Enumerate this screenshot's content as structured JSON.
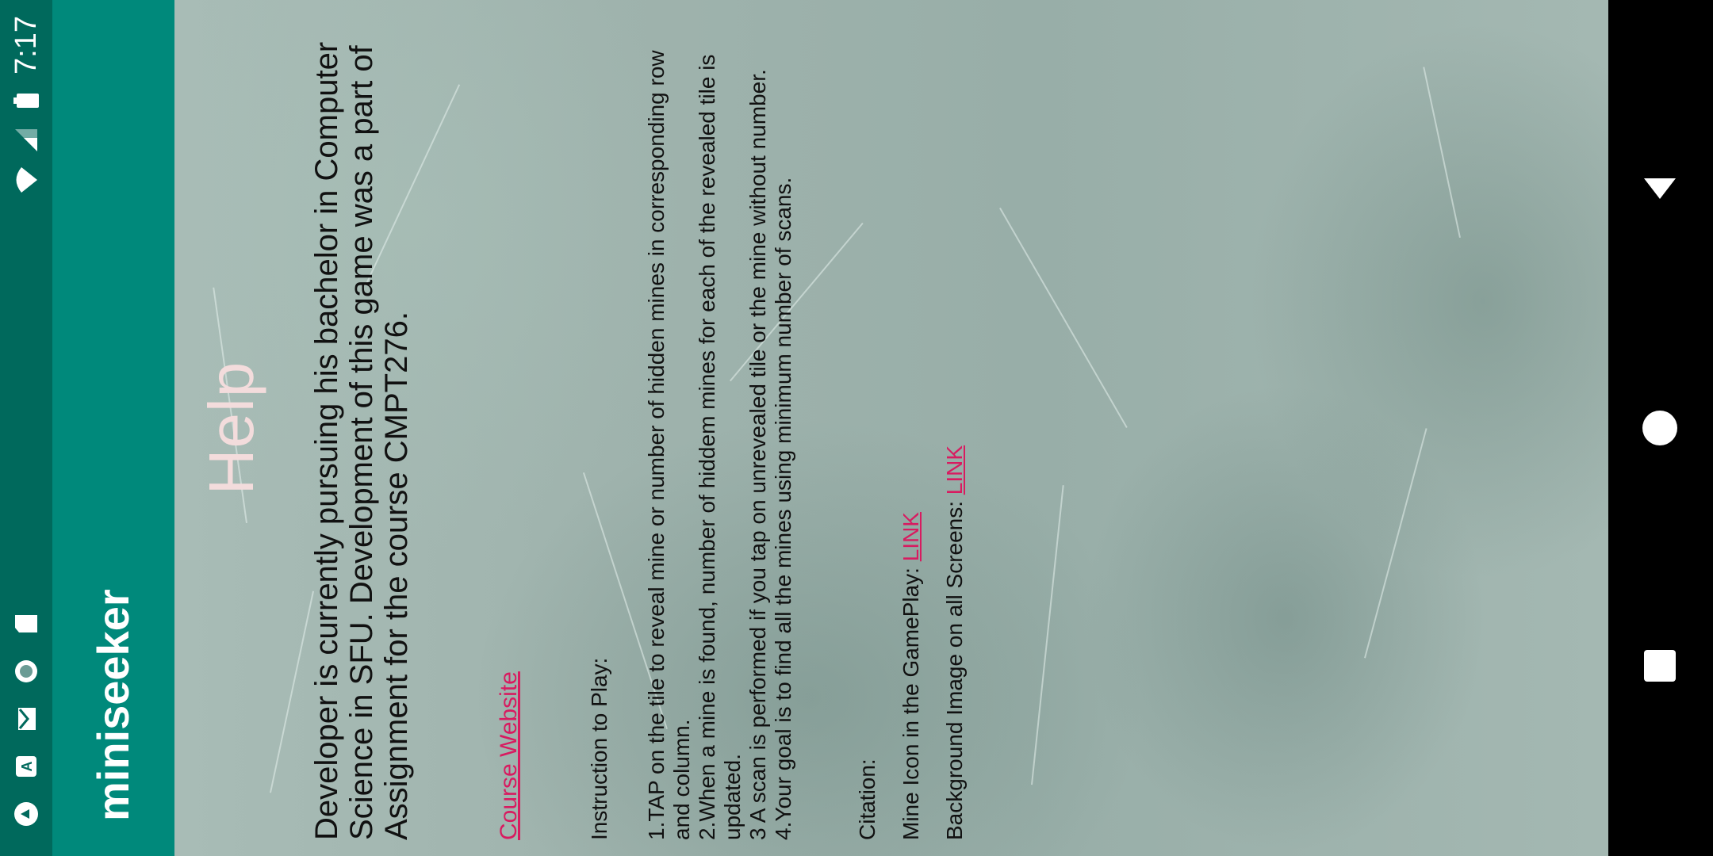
{
  "status_bar": {
    "time": "7:17",
    "left_icons": [
      "warning-notification-icon",
      "app-store-notification-icon",
      "gmail-notification-icon",
      "circle-notification-icon",
      "sd-card-notification-icon"
    ],
    "right_icons": [
      "wifi-icon",
      "cellular-signal-icon",
      "battery-icon"
    ]
  },
  "app_bar": {
    "title": "miniseeker"
  },
  "help": {
    "title": "Help",
    "developer_text": "Developer is currently pursuing his bachelor in Computer Science in SFU. Development of this game was a part of Assignment for the course CMPT276.",
    "course_link": "Course Website",
    "instructions_heading": "Instruction to Play:",
    "instructions": [
      "1.TAP on the tile to reveal mine or number of hidden mines in corresponding row and column.",
      "2.When a mine is found, number of hiddem mines for each of the revealed tile is updated.",
      "3 A scan is performed if you tap on unrevealed tile or the mine without number.",
      "4.Your goal is to find all the mines using minimum number of scans."
    ],
    "citation_heading": "Citation:",
    "citations": [
      {
        "label": "Mine Icon in the GamePlay: ",
        "link": "LINK"
      },
      {
        "label": "Background Image on all Screens: ",
        "link": "LINK"
      }
    ]
  },
  "nav_bar": {
    "buttons": [
      "back",
      "home",
      "recents"
    ]
  },
  "colors": {
    "status_bar": "#00695c",
    "app_bar": "#00897b",
    "link": "#d81b60",
    "title": "#f3dcdc"
  }
}
